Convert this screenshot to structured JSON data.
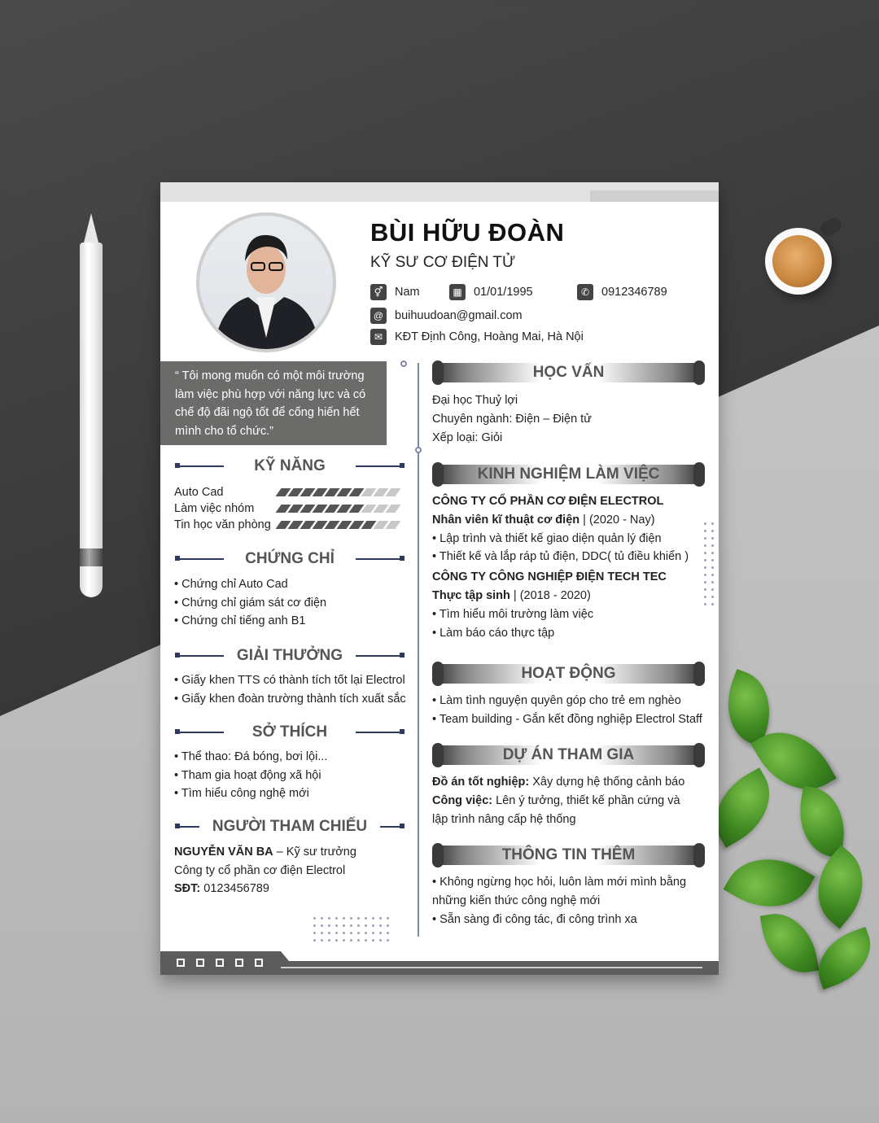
{
  "cv": {
    "name": "BÙI HỮU ĐOÀN",
    "title": "KỸ SƯ CƠ ĐIỆN TỬ",
    "gender": "Nam",
    "dob": "01/01/1995",
    "phone": "0912346789",
    "email": "buihuudoan@gmail.com",
    "address": "KĐT Định Công, Hoàng Mai, Hà Nội",
    "quote": "“ Tôi mong muốn có một môi trường làm việc phù hợp với năng lực và có chế độ đãi ngộ tốt để cống hiến hết mình cho tổ chức.”"
  },
  "left": {
    "skills_title": "KỸ NĂNG",
    "skills": [
      {
        "name": "Auto Cad",
        "level": 7,
        "max": 10
      },
      {
        "name": "Làm việc nhóm",
        "level": 7,
        "max": 10
      },
      {
        "name": "Tin học văn phòng",
        "level": 8,
        "max": 10
      }
    ],
    "cert_title": "CHỨNG CHỈ",
    "certs": [
      "• Chứng chỉ Auto Cad",
      "• Chứng chỉ giám sát cơ điện",
      "• Chứng chỉ tiếng anh B1"
    ],
    "award_title": "GIẢI THƯỞNG",
    "awards": [
      "• Giấy khen TTS có thành tích tốt lại Electrol",
      "• Giấy khen đoàn trường thành tích xuất sắc"
    ],
    "hobby_title": "SỞ THÍCH",
    "hobbies": [
      "• Thể thao: Đá bóng, bơi lội...",
      "• Tham gia hoạt động xã hội",
      "• Tìm hiểu công nghệ mới"
    ],
    "ref_title": "NGƯỜI THAM CHIẾU",
    "ref_name": "NGUYỄN VĂN BA",
    "ref_role": " – Kỹ sư trưởng",
    "ref_company": "Công ty cổ phần cơ điện Electrol",
    "ref_phone_label": "SĐT:",
    "ref_phone": " 0123456789"
  },
  "right": {
    "edu_title": "HỌC VẤN",
    "edu": [
      "Đại học Thuỷ lợi",
      "Chuyên ngành: Điện – Điện tử",
      "Xếp loại: Giỏi"
    ],
    "exp_title": "KINH NGHIỆM LÀM VIỆC",
    "exp": [
      {
        "company": "CÔNG TY CỔ PHẦN CƠ ĐIỆN ELECTROL",
        "role": "Nhân viên kĩ thuật cơ điện",
        "period": " | (2020 - Nay)",
        "items": [
          "• Lập trình và thiết kế giao diện quản lý điện",
          "• Thiết kế và lắp ráp tủ điện, DDC( tủ điều khiển )"
        ]
      },
      {
        "company": "CÔNG TY  CÔNG NGHIỆP ĐIỆN TECH TEC",
        "role": "Thực tập sinh",
        "period": " | (2018 - 2020)",
        "items": [
          "• Tìm hiểu môi trường làm việc",
          "• Làm báo cáo thực tập"
        ]
      }
    ],
    "act_title": "HOẠT ĐỘNG",
    "acts": [
      "• Làm tình nguyện quyên góp cho trẻ em nghèo",
      "• Team building - Gắn kết đồng nghiệp Electrol Staff"
    ],
    "proj_title": "DỰ ÁN THAM GIA",
    "proj_label1": "Đồ án tốt nghiệp:",
    "proj_text1": " Xây dựng hệ thống cảnh báo",
    "proj_label2": "Công việc:",
    "proj_text2": " Lên ý tưởng, thiết kế phần cứng và",
    "proj_text3": "lập trình nâng cấp hệ thống",
    "more_title": "THÔNG TIN THÊM",
    "more": [
      "• Không ngừng học hỏi, luôn làm mới mình bằng",
      "những kiến thức công nghệ mới",
      "• Sẵn sàng đi công tác, đi công trình xa"
    ]
  },
  "colors": {
    "accent": "#2d3a5e",
    "quote_bg": "#6b6b69",
    "heading": "#555555"
  }
}
